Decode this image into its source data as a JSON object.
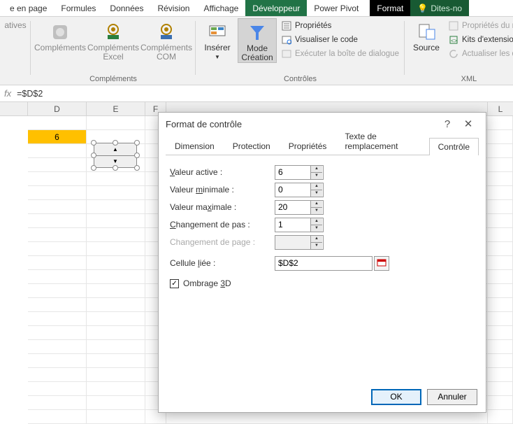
{
  "tabs": {
    "mise_en_page": "e en page",
    "formules": "Formules",
    "donnees": "Données",
    "revision": "Révision",
    "affichage": "Affichage",
    "developpeur": "Développeur",
    "power_pivot": "Power Pivot",
    "format": "Format",
    "tell_me": "Dites-no"
  },
  "ribbon": {
    "natives": "atives",
    "complements": "Compléments",
    "complements_excel": "Compléments\nExcel",
    "complements_com": "Compléments\nCOM",
    "group_complements": "Compléments",
    "inserer": "Insérer",
    "mode_creation": "Mode\nCréation",
    "proprietes": "Propriétés",
    "visualiser": "Visualiser le code",
    "executer": "Exécuter la boîte de dialogue",
    "group_controles": "Contrôles",
    "source": "Source",
    "map_props": "Propriétés du map",
    "kits_ext": "Kits d'extension",
    "actualiser": "Actualiser les don",
    "group_xml": "XML"
  },
  "formula": "=$D$2",
  "columns": [
    "D",
    "E",
    "F",
    "",
    "",
    "",
    "",
    "",
    "",
    "",
    "L"
  ],
  "cell_value": "6",
  "dialog": {
    "title": "Format de contrôle",
    "tabs": {
      "dimension": "Dimension",
      "protection": "Protection",
      "proprietes": "Propriétés",
      "texte": "Texte de remplacement",
      "controle": "Contrôle"
    },
    "fields": {
      "valeur_active_label": "Valeur active :",
      "valeur_active": "6",
      "valeur_min_label_pre": "Valeur ",
      "valeur_min_label_u": "m",
      "valeur_min_label_post": "inimale :",
      "valeur_min": "0",
      "valeur_max_label_pre": "Valeur ma",
      "valeur_max_label_u": "x",
      "valeur_max_label_post": "imale :",
      "valeur_max": "20",
      "chg_pas_label_u": "C",
      "chg_pas_label_post": "hangement de pas :",
      "chg_pas": "1",
      "chg_page_label": "Changement de page :",
      "chg_page": "",
      "cell_liee_label_pre": "Cellule ",
      "cell_liee_label_u": "l",
      "cell_liee_label_post": "iée :",
      "cell_liee": "$D$2",
      "ombrage_pre": "Ombrage ",
      "ombrage_u": "3",
      "ombrage_post": "D"
    },
    "ok": "OK",
    "annuler": "Annuler"
  }
}
